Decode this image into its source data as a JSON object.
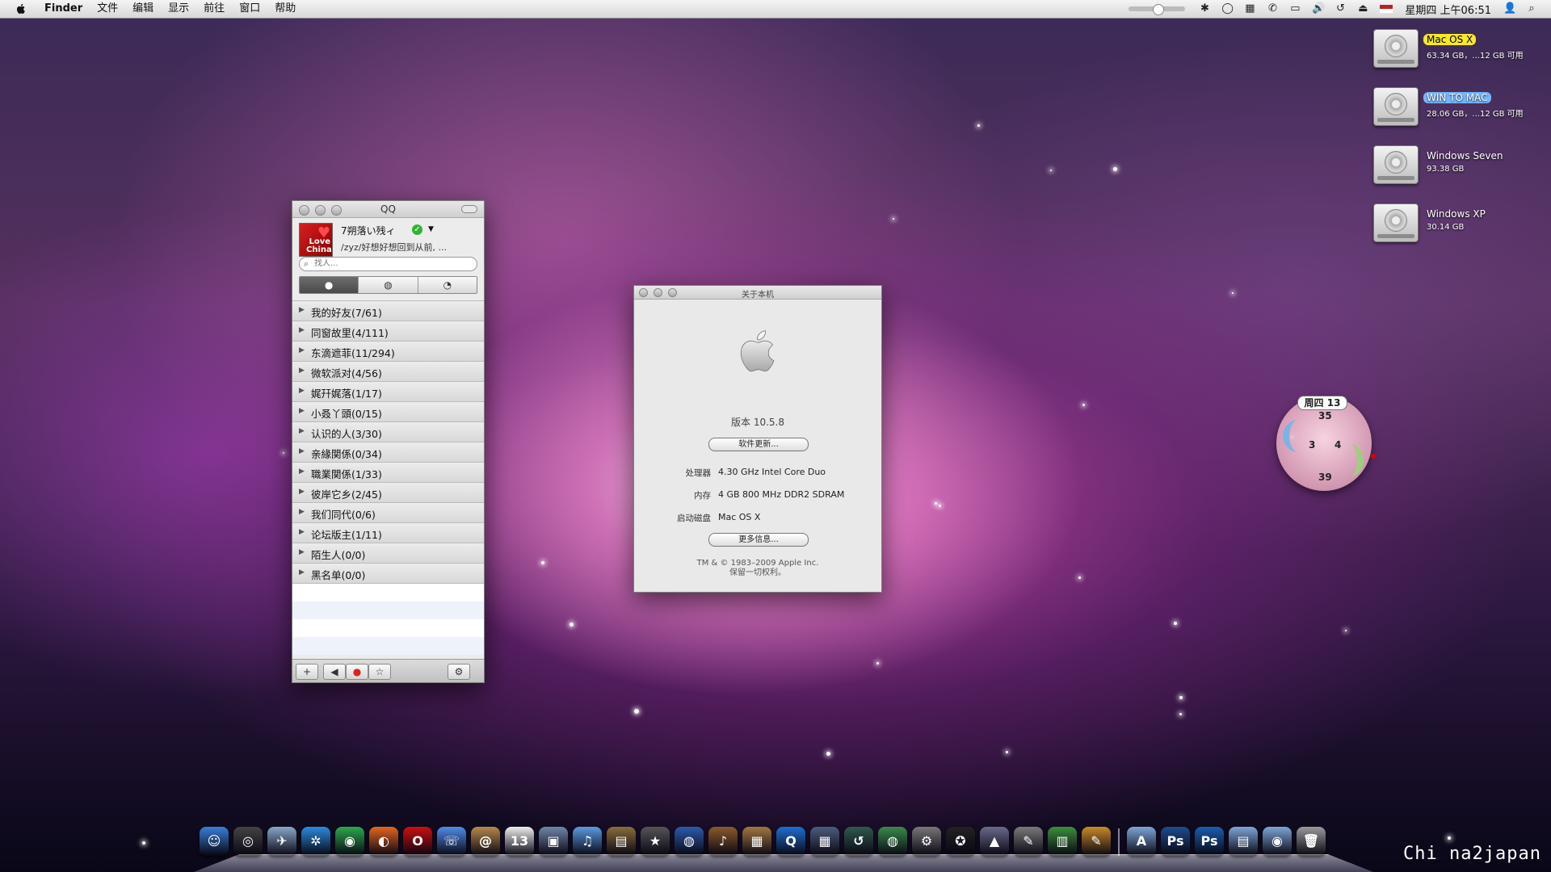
{
  "menubar": {
    "app_name": "Finder",
    "items": [
      "文件",
      "编辑",
      "显示",
      "前往",
      "窗口",
      "帮助"
    ],
    "clock": "星期四 上午06:51"
  },
  "desktop": {
    "drives": [
      {
        "name": "Mac OS X",
        "info": "63.34 GB，...12 GB 可用",
        "highlight": "yellow"
      },
      {
        "name": "WIN TO MAC",
        "info": "28.06 GB，...12 GB 可用",
        "highlight": "blue"
      },
      {
        "name": "Windows Seven",
        "info": "93.38 GB",
        "highlight": ""
      },
      {
        "name": "Windows XP",
        "info": "30.14 GB",
        "highlight": ""
      }
    ]
  },
  "qq": {
    "title": "QQ",
    "avatar_text": "Love China",
    "nickname": "7朔落い残ィ",
    "signature": "/zyz/好想好想回到从前, ...",
    "search_placeholder": "找人...",
    "groups": [
      "我的好友(7/61)",
      "同窗故里(4/111)",
      "东滴遮菲(11/294)",
      "微软派对(4/56)",
      "娓幵娓落(1/17)",
      "小叒丫頭(0/15)",
      "认识的人(3/30)",
      "亲緣関係(0/34)",
      "職業関係(1/33)",
      "彼岸它乡(2/45)",
      "我们同代(0/6)",
      "论坛版主(1/11)",
      "陌生人(0/0)",
      "黑名单(0/0)"
    ]
  },
  "about": {
    "title": "关于本机",
    "version": "版本 10.5.8",
    "software_update": "软件更新...",
    "processor_label": "处理器",
    "processor": "4.30 GHz Intel Core Duo",
    "memory_label": "内存",
    "memory": "4 GB 800 MHz DDR2 SDRAM",
    "startup_label": "启动磁盘",
    "startup": "Mac OS X",
    "more_info": "更多信息...",
    "copyright": "TM & © 1983–2009 Apple Inc.",
    "rights": "保留一切权利。"
  },
  "clock_widget": {
    "day": "周四 13",
    "top": "35",
    "left": "3",
    "right": "4",
    "bottom": "39"
  },
  "dock": {
    "icons": [
      {
        "name": "finder-icon",
        "color": "#3a7fd8",
        "glyph": "☺"
      },
      {
        "name": "dashboard-icon",
        "color": "#444444",
        "glyph": "◎"
      },
      {
        "name": "mail-icon",
        "color": "#8aa7c9",
        "glyph": "✈"
      },
      {
        "name": "safari-icon",
        "color": "#2b8cdc",
        "glyph": "✲"
      },
      {
        "name": "chrome-icon",
        "color": "#2da94f",
        "glyph": "◉"
      },
      {
        "name": "firefox-icon",
        "color": "#e3661d",
        "glyph": "◐"
      },
      {
        "name": "opera-icon",
        "color": "#cc1010",
        "glyph": "O"
      },
      {
        "name": "ichat-icon",
        "color": "#4f8de8",
        "glyph": "☏"
      },
      {
        "name": "address-book-icon",
        "color": "#b7894c",
        "glyph": "@"
      },
      {
        "name": "calendar-icon",
        "color": "#efefef",
        "glyph": "13"
      },
      {
        "name": "iphoto-icon",
        "color": "#6f86a8",
        "glyph": "▣"
      },
      {
        "name": "itunes-icon",
        "color": "#5b9be0",
        "glyph": "♫"
      },
      {
        "name": "image-capture-icon",
        "color": "#8a6d3b",
        "glyph": "▤"
      },
      {
        "name": "imovie-icon",
        "color": "#555555",
        "glyph": "★"
      },
      {
        "name": "dvd-player-icon",
        "color": "#2a5caa",
        "glyph": "◍"
      },
      {
        "name": "garageband-icon",
        "color": "#8a5a2a",
        "glyph": "♪"
      },
      {
        "name": "preview-icon",
        "color": "#a07840",
        "glyph": "▦"
      },
      {
        "name": "quicktime-icon",
        "color": "#1e6fd0",
        "glyph": "Q"
      },
      {
        "name": "spaces-icon",
        "color": "#4a5d7c",
        "glyph": "▦"
      },
      {
        "name": "time-machine-icon",
        "color": "#2f5a4d",
        "glyph": "↺"
      },
      {
        "name": "network-icon",
        "color": "#3a8a4a",
        "glyph": "◍"
      },
      {
        "name": "system-preferences-icon",
        "color": "#777777",
        "glyph": "⚙"
      },
      {
        "name": "qq-icon",
        "color": "#222222",
        "glyph": "✪"
      },
      {
        "name": "keynote-icon",
        "color": "#6a6a8a",
        "glyph": "▲"
      },
      {
        "name": "script-editor-icon",
        "color": "#7a7a7a",
        "glyph": "✎"
      },
      {
        "name": "numbers-icon",
        "color": "#3c8f3c",
        "glyph": "▥"
      },
      {
        "name": "pages-icon",
        "color": "#c98a2a",
        "glyph": "✎"
      }
    ],
    "stack_icons": [
      {
        "name": "applications-folder-icon",
        "color": "#7ea6d6",
        "glyph": "A"
      },
      {
        "name": "photoshop-icon",
        "color": "#1f4c8f",
        "glyph": "Ps"
      },
      {
        "name": "photoshop-cs-icon",
        "color": "#1a5fb0",
        "glyph": "Ps"
      },
      {
        "name": "documents-folder-icon",
        "color": "#7ea6d6",
        "glyph": "▤"
      },
      {
        "name": "downloads-folder-icon",
        "color": "#7ea6d6",
        "glyph": "◉"
      },
      {
        "name": "trash-icon",
        "color": "#9a9a9a",
        "glyph": "🗑"
      }
    ]
  },
  "watermark": "Chi na2japan"
}
